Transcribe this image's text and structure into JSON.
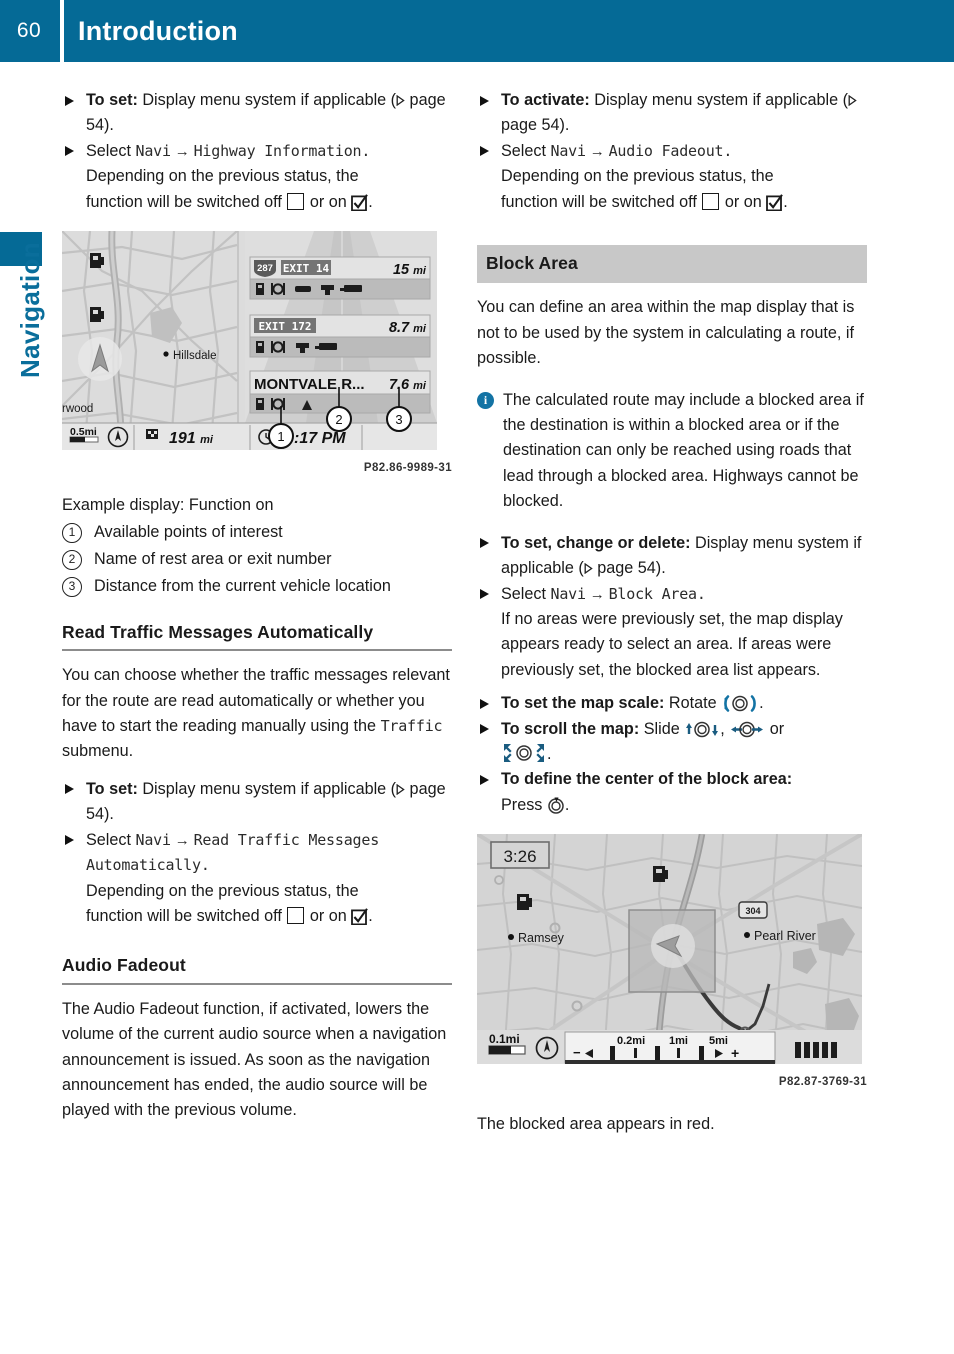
{
  "header": {
    "page_number": "60",
    "title": "Introduction",
    "side_tab": "Navigation",
    "accent_color": "#056A96"
  },
  "left_column": {
    "step_to_set_highway": {
      "lead": "To set:",
      "text": " Display menu system if applicable (",
      "page_ref": " page 54).",
      "page_ref_number": "54"
    },
    "step_select_highway": {
      "select": "Select ",
      "path_root": "Navi",
      "arrow": " → ",
      "path_leaf": "Highway Information",
      "period": ".",
      "followup_1": "Depending on the previous status, the",
      "followup_2": "function will be switched off",
      "followup_3": "or on",
      "followup_end": "."
    },
    "figure1": {
      "code": "P82.86-9989-31",
      "exit1_shield": "287",
      "exit1_label": "EXIT 14",
      "exit1_distance": "15 mi",
      "exit2_label": "EXIT 172",
      "exit2_distance": "8.7 mi",
      "exit3_label": "MONTVALE R...",
      "exit3_distance": "7.6 mi",
      "map_town": "Hillsdale",
      "map_town2": "rwood",
      "scale": "0.5mi",
      "remaining_distance": "191 mi",
      "arrival_time": ":17 PM",
      "callouts": [
        "1",
        "2",
        "3"
      ]
    },
    "figure1_caption": "Example display: Function on",
    "legend": [
      {
        "num": "1",
        "text": "Available points of interest"
      },
      {
        "num": "2",
        "text": "Name of rest area or exit number"
      },
      {
        "num": "3",
        "text": "Distance from the current vehicle location"
      }
    ],
    "section_read_traffic": {
      "heading": "Read Traffic Messages Automatically",
      "body_1": "You can choose whether the traffic messages relevant for the route are read automatically or whether you have to start the reading manually using the ",
      "body_mono": "Traffic",
      "body_2": " submenu.",
      "step_to_set_lead": "To set:",
      "step_to_set_text": " Display menu system if applicable (",
      "step_to_set_ref": " page 54).",
      "step_select": "Select ",
      "path_root": "Navi",
      "arrow": " → ",
      "path_leaf": "Read Traffic Messages Automatically",
      "period": ".",
      "followup_1": "Depending on the previous status, the",
      "followup_2": "function will be switched off",
      "followup_3": "or on",
      "followup_end": "."
    },
    "section_audio_fadeout": {
      "heading": "Audio Fadeout",
      "body": "The Audio Fadeout function, if activated, lowers the volume of the current audio source when a navigation announcement is issued. As soon as the navigation announcement has ended, the audio source will be played with the previous volume."
    }
  },
  "right_column": {
    "step_to_activate": {
      "lead": "To activate:",
      "text": " Display menu system if applicable (",
      "page_ref": " page 54)."
    },
    "step_select_audio": {
      "select": "Select ",
      "path_root": "Navi",
      "arrow": " → ",
      "path_leaf": "Audio Fadeout",
      "period": ".",
      "followup_1": "Depending on the previous status, the",
      "followup_2": "function will be switched off",
      "followup_3": "or on",
      "followup_end": "."
    },
    "section_block_area": {
      "heading": "Block Area",
      "body": "You can define an area within the map display that is not to be used by the system in calculating a route, if possible.",
      "note": "The calculated route may include a blocked area if the destination is within a blocked area or if the destination can only be reached using roads that lead through a blocked area. Highways cannot be blocked.",
      "step_set_change_lead": "To set, change or delete:",
      "step_set_change_text": " Display menu system if applicable (",
      "step_set_change_ref": " page 54).",
      "step_select": "Select ",
      "path_root": "Navi",
      "arrow": " → ",
      "path_leaf": "Block Area",
      "period": ".",
      "step_select_follow": "If no areas were previously set, the map display appears ready to select an area. If areas were previously set, the blocked area list appears.",
      "step_scale_lead": "To set the map scale:",
      "step_scale_text": " Rotate ",
      "step_scale_end": ".",
      "step_scroll_lead": " To scroll the map:",
      "step_scroll_text": " Slide ",
      "step_scroll_comma": ", ",
      "step_scroll_or": " or",
      "step_scroll_end": ".",
      "step_center_lead": "To define the center of the block area:",
      "step_center_text": "Press ",
      "step_center_end": "."
    },
    "figure2": {
      "code": "P82.87-3769-31",
      "clock": "3:26",
      "town_left": "Ramsey",
      "town_right": "Pearl River",
      "route_shield": "304",
      "scale": "0.1mi",
      "zoom_labels": [
        "0.2mi",
        "1mi",
        "5mi"
      ],
      "zoom_minus": "−",
      "zoom_plus": "+"
    },
    "figure2_caption": "The blocked area appears in red."
  }
}
